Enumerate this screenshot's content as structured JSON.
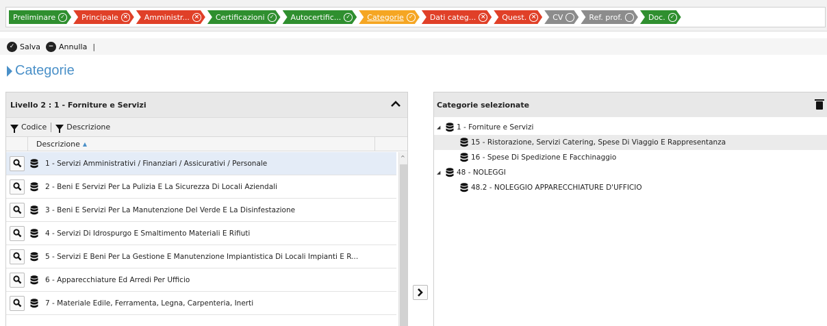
{
  "steps": [
    {
      "label": "Preliminare",
      "color": "green",
      "status": "ok"
    },
    {
      "label": "Principale",
      "color": "red",
      "status": "error"
    },
    {
      "label": "Amministr...",
      "color": "red",
      "status": "error"
    },
    {
      "label": "Certificazioni",
      "color": "green",
      "status": "ok"
    },
    {
      "label": "Autocertific...",
      "color": "green",
      "status": "ok"
    },
    {
      "label": "Categorie",
      "color": "orange",
      "status": "ok",
      "current": true
    },
    {
      "label": "Dati categ...",
      "color": "red",
      "status": "error"
    },
    {
      "label": "Quest.",
      "color": "red",
      "status": "error"
    },
    {
      "label": "CV",
      "color": "gray",
      "status": "empty"
    },
    {
      "label": "Ref. prof.",
      "color": "gray",
      "status": "empty"
    },
    {
      "label": "Doc.",
      "color": "green",
      "status": "ok"
    }
  ],
  "colors": {
    "green": "#2f8f2f",
    "red": "#e04028",
    "orange": "#f5a623",
    "gray": "#8c8c8c",
    "title_blue": "#4a90c8"
  },
  "toolbar": {
    "save_label": "Salva",
    "cancel_label": "Annulla",
    "separator": "|"
  },
  "page_title": "Categorie",
  "left_panel": {
    "title": "Livello 2 : 1 - Forniture e Servizi",
    "filters": {
      "codice": "Codice",
      "descrizione": "Descrizione"
    },
    "column_header": "Descrizione",
    "rows": [
      "1 - Servizi Amministrativi / Finanziari / Assicurativi / Personale",
      "2 - Beni E Servizi Per La Pulizia E La Sicurezza Di Locali Aziendali",
      "3 - Beni E Servizi Per La Manutenzione Del Verde E La Disinfestazione",
      "4 - Servizi Di Idrospurgo E Smaltimento Materiali E Rifiuti",
      "5 - Servizi E Beni Per La Gestione E Manutenzione Impiantistica Di Locali Impianti E R...",
      "6 - Apparecchiature Ed Arredi Per Ufficio",
      "7 - Materiale Edile, Ferramenta, Legna, Carpenteria, Inerti"
    ],
    "selected_row": 0
  },
  "right_panel": {
    "title": "Categorie selezionate",
    "tree": [
      {
        "label": "1 - Forniture e Servizi",
        "level": 0,
        "expanded": true
      },
      {
        "label": "15 - Ristorazione, Servizi Catering, Spese Di Viaggio E Rappresentanza",
        "level": 1,
        "highlight": true
      },
      {
        "label": "16 - Spese Di Spedizione E Facchinaggio",
        "level": 1
      },
      {
        "label": "48 - NOLEGGI",
        "level": 0,
        "expanded": true
      },
      {
        "label": "48.2 - NOLEGGIO APPARECCHIATURE D'UFFICIO",
        "level": 1
      }
    ]
  }
}
